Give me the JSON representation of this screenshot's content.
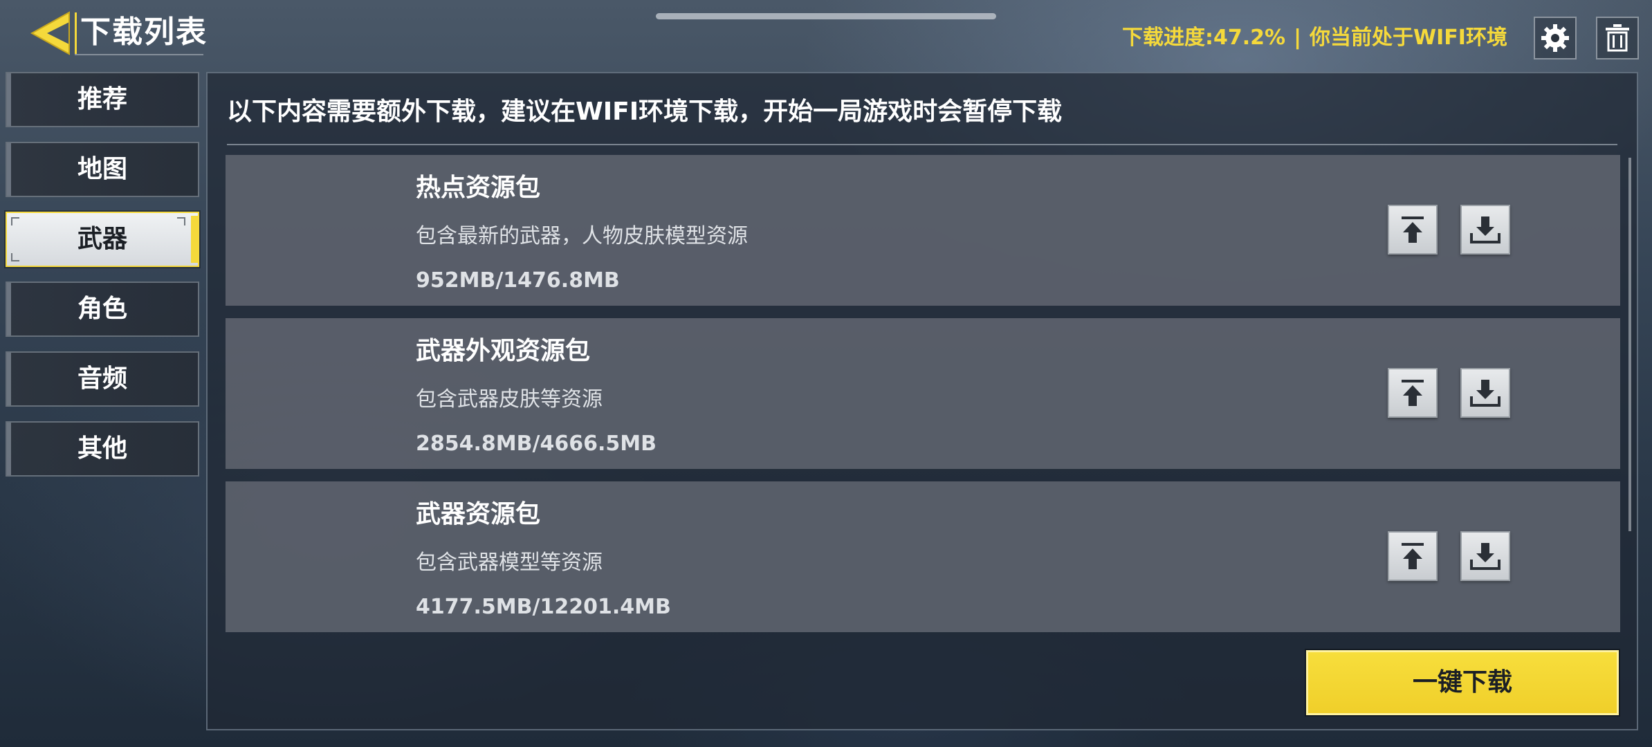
{
  "header": {
    "title": "下载列表",
    "progress_text": "下载进度:47.2%",
    "separator": "|",
    "network_text": "你当前处于WIFI环境"
  },
  "icons": {
    "back": "back-arrow-icon",
    "settings": "gear-icon",
    "delete": "trash-icon",
    "upload": "arrow-up-icon",
    "download": "download-icon"
  },
  "sidebar": {
    "items": [
      {
        "label": "推荐"
      },
      {
        "label": "地图"
      },
      {
        "label": "武器"
      },
      {
        "label": "角色"
      },
      {
        "label": "音频"
      },
      {
        "label": "其他"
      }
    ],
    "active_index": 2
  },
  "main": {
    "notice": "以下内容需要额外下载，建议在WIFI环境下载，开始一局游戏时会暂停下载",
    "packages": [
      {
        "title": "热点资源包",
        "description": "包含最新的武器，人物皮肤模型资源",
        "size": "952MB/1476.8MB"
      },
      {
        "title": "武器外观资源包",
        "description": "包含武器皮肤等资源",
        "size": "2854.8MB/4666.5MB"
      },
      {
        "title": "武器资源包",
        "description": "包含武器模型等资源",
        "size": "4177.5MB/12201.4MB"
      }
    ],
    "one_click_label": "一键下载"
  },
  "colors": {
    "accent": "#f5d93b",
    "card_bg": "#5c626c",
    "text": "#ffffff"
  }
}
